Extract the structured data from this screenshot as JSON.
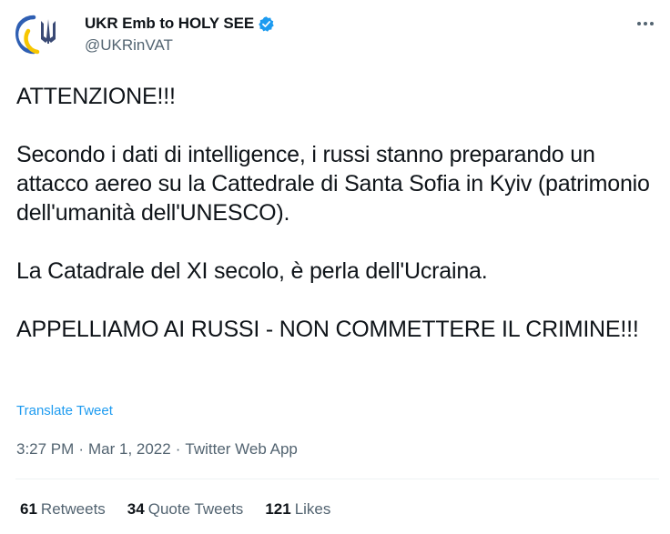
{
  "account": {
    "display_name": "UKR Emb to HOLY SEE",
    "handle": "@UKRinVAT",
    "verified_icon": "verified-badge-icon",
    "avatar_icon": "ukraine-trident-icon",
    "colors": {
      "flag_blue": "#2f5fb3",
      "flag_yellow": "#f7c600",
      "verified": "#1d9bf0"
    }
  },
  "menu": {
    "more_icon": "more-horizontal-icon"
  },
  "tweet": {
    "paragraphs": [
      "ATTENZIONE!!!",
      "Secondo i dati di intelligence, i russi stanno preparando un attacco aereo su la Cattedrale di Santa Sofia in Kyiv (patrimonio dell'umanità dell'UNESCO).",
      "La Catadrale del XI secolo, è perla dell'Ucraina.",
      "APPELLIAMO AI RUSSI - NON COMMETTERE IL CRIMINE!!!"
    ],
    "translate_label": "Translate Tweet"
  },
  "meta": {
    "time": "3:27 PM",
    "date": "Mar 1, 2022",
    "source": "Twitter Web App",
    "separator": "·"
  },
  "stats": {
    "retweets": {
      "count": "61",
      "label": "Retweets"
    },
    "quote_tweets": {
      "count": "34",
      "label": "Quote Tweets"
    },
    "likes": {
      "count": "121",
      "label": "Likes"
    }
  }
}
